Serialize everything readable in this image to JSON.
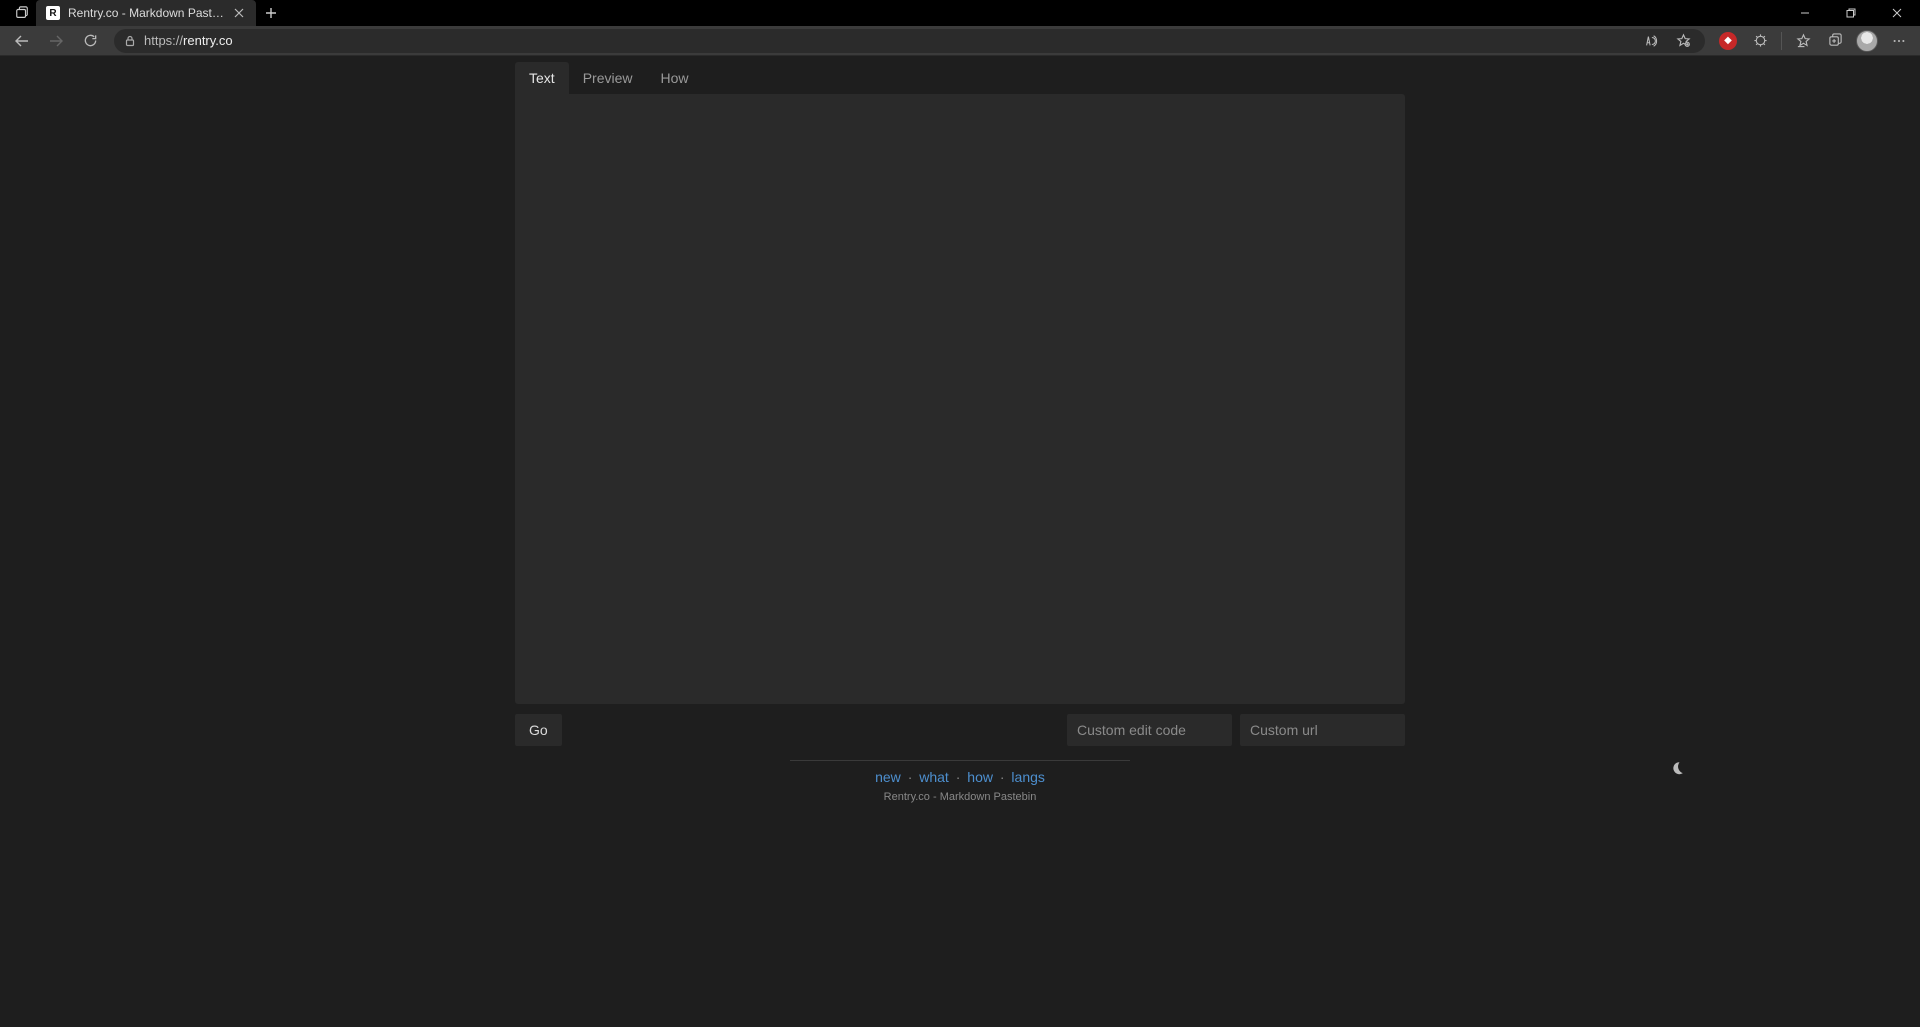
{
  "browser": {
    "tab_title": "Rentry.co - Markdown Pastebin",
    "favicon_letter": "R",
    "url_display_prefix": "https://",
    "url_display_host": "rentry.co"
  },
  "page": {
    "tabs": {
      "text": "Text",
      "preview": "Preview",
      "how": "How"
    },
    "editor_value": "",
    "go_label": "Go",
    "edit_code_placeholder": "Custom edit code",
    "url_placeholder": "Custom url",
    "footer_links": {
      "new": "new",
      "what": "what",
      "how": "how",
      "langs": "langs"
    },
    "footer_tagline": "Rentry.co - Markdown Pastebin"
  }
}
